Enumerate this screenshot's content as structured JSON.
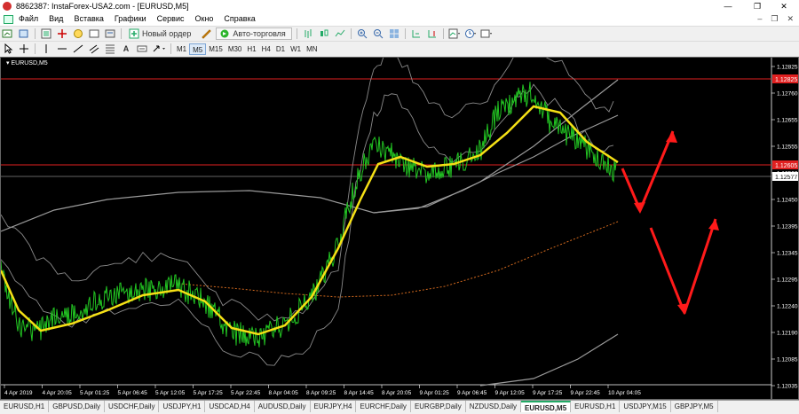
{
  "window": {
    "title": "8862387: InstaForex-USA2.com - [EURUSD,M5]",
    "min": "—",
    "max": "❐",
    "close": "✕"
  },
  "menu": {
    "items": [
      "Файл",
      "Вид",
      "Вставка",
      "Графики",
      "Сервис",
      "Окно",
      "Справка"
    ],
    "mdi_min": "–",
    "mdi_restore": "❐",
    "mdi_close": "✕"
  },
  "toolbar": {
    "new_order": "Новый ордер",
    "auto_trading": "Авто-торговля",
    "timeframes": [
      "M1",
      "M5",
      "M15",
      "M30",
      "H1",
      "H4",
      "D1",
      "W1",
      "MN"
    ],
    "active_timeframe": "M5",
    "text_tool": "A"
  },
  "chart": {
    "symbol_label": "EURUSD,M5",
    "price_ticks": [
      "1.12825",
      "1.12760",
      "1.12655",
      "1.12555",
      "1.12500",
      "1.12450",
      "1.12395",
      "1.12345",
      "1.12295",
      "1.12240",
      "1.12190",
      "1.12085",
      "1.12035"
    ],
    "time_ticks": [
      "4 Apr 2019",
      "4 Apr 20:05",
      "5 Apr 01:25",
      "5 Apr 06:45",
      "5 Apr 12:05",
      "5 Apr 17:25",
      "5 Apr 22:45",
      "8 Apr 04:05",
      "8 Apr 09:25",
      "8 Apr 14:45",
      "8 Apr 20:05",
      "9 Apr 01:25",
      "9 Apr 06:45",
      "9 Apr 12:05",
      "9 Apr 17:25",
      "9 Apr 22:45",
      "10 Apr 04:05"
    ],
    "level_labels": [
      "1.12825",
      "1.12605",
      "1.12577"
    ],
    "colors": {
      "background": "#000000",
      "price": "#22c422",
      "moving_average": "#f5e015",
      "level_red": "#e02020",
      "channel": "#9a9a9a",
      "projection": "#ff1a1a",
      "dotted_curve": "#d2691e"
    }
  },
  "tabs": {
    "items": [
      "EURUSD,H1",
      "GBPUSD,Daily",
      "USDCHF,Daily",
      "USDJPY,H1",
      "USDCAD,H4",
      "AUDUSD,Daily",
      "EURJPY,H4",
      "EURCHF,Daily",
      "EURGBP,Daily",
      "NZDUSD,Daily",
      "EURUSD,M5",
      "EURUSD,H1",
      "USDJPY,M15",
      "GBPJPY,M5"
    ],
    "active": "EURUSD,M5"
  }
}
